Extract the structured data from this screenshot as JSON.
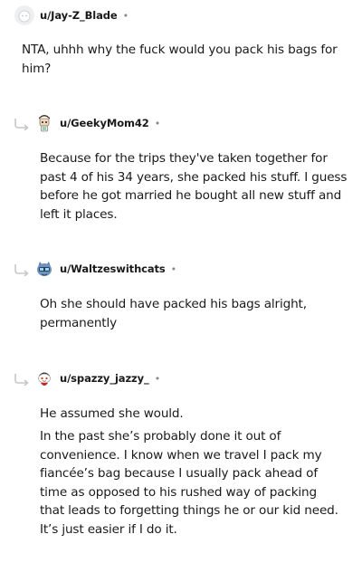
{
  "comments": [
    {
      "username": "u/Jay-Z_Blade",
      "separator": "•",
      "avatar_icon": "default-avatar-icon",
      "paragraphs": [
        "NTA, uhhh why the fuck would you pack his bags for him?"
      ]
    },
    {
      "username": "u/GeekyMom42",
      "separator": "•",
      "avatar_icon": "robot-avatar-icon",
      "paragraphs": [
        "Because for the trips they've taken together for past 4 of his 34 years, she packed his stuff. I guess before he got married he bought all new stuff and left it places."
      ]
    },
    {
      "username": "u/Waltzeswithcats",
      "separator": "•",
      "avatar_icon": "cat-avatar-icon",
      "paragraphs": [
        "Oh she should have packed his bags alright, permanently"
      ]
    },
    {
      "username": "u/spazzy_jazzy_",
      "separator": "•",
      "avatar_icon": "snoo-avatar-icon",
      "paragraphs": [
        "He assumed she would.",
        "In the past she’s probably done it out of convenience. I know when we travel I pack my fiancée’s bag because I usually pack ahead of time as opposed to his rushed way of packing that leads to forgetting things he or our kid need. It’s just easier if I do it."
      ]
    }
  ],
  "colors": {
    "text": "#1a1a1b",
    "meta": "#878a8c",
    "reply_arrow": "#c7c7c7"
  }
}
